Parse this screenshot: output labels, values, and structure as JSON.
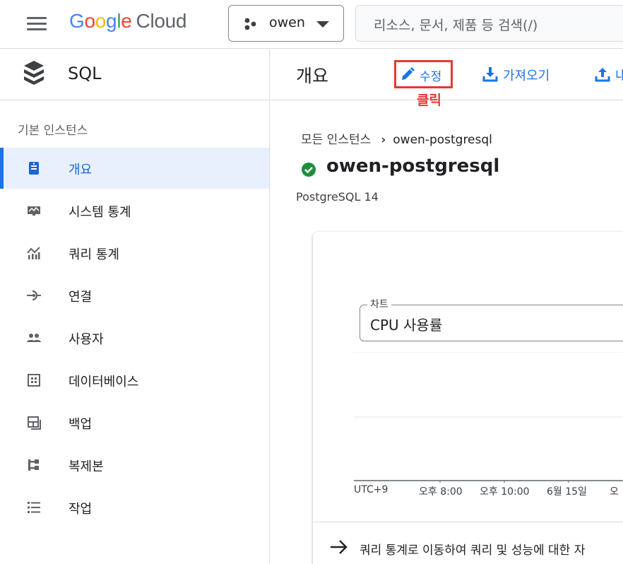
{
  "header": {
    "logo_google": [
      "G",
      "o",
      "o",
      "g",
      "l",
      "e"
    ],
    "logo_cloud": "Cloud",
    "project_name": "owen",
    "search_placeholder": "리소스, 문서, 제품 등 검색(/)"
  },
  "sidebar": {
    "title": "SQL",
    "section_label": "기본 인스턴스",
    "items": [
      {
        "label": "개요",
        "icon": "overview-icon",
        "active": true
      },
      {
        "label": "시스템 통계",
        "icon": "system-stats-icon"
      },
      {
        "label": "쿼리 통계",
        "icon": "query-stats-icon"
      },
      {
        "label": "연결",
        "icon": "connection-icon"
      },
      {
        "label": "사용자",
        "icon": "users-icon"
      },
      {
        "label": "데이터베이스",
        "icon": "database-icon"
      },
      {
        "label": "백업",
        "icon": "backup-icon"
      },
      {
        "label": "복제본",
        "icon": "replica-icon"
      },
      {
        "label": "작업",
        "icon": "operations-icon"
      }
    ]
  },
  "main": {
    "page_title": "개요",
    "actions": {
      "edit": "수정",
      "import": "가져오기",
      "export": "내"
    },
    "annotation": "클릭",
    "breadcrumb": {
      "root": "모든 인스턴스",
      "current": "owen-postgresql"
    },
    "instance_name": "owen-postgresql",
    "db_version": "PostgreSQL 14",
    "chart_card": {
      "select_legend": "차트",
      "select_value": "CPU 사용률",
      "axis_ticks": [
        "UTC+9",
        "오후 8:00",
        "오후 10:00",
        "6월 15일",
        "오"
      ],
      "footer_text": "쿼리 통계로 이동하여 쿼리 및 성능에 대한 자"
    }
  },
  "colors": {
    "accent": "#1a73e8",
    "highlight": "#e53935",
    "status_ok": "#1e8e3e",
    "active_bg": "#e8f0fe"
  }
}
